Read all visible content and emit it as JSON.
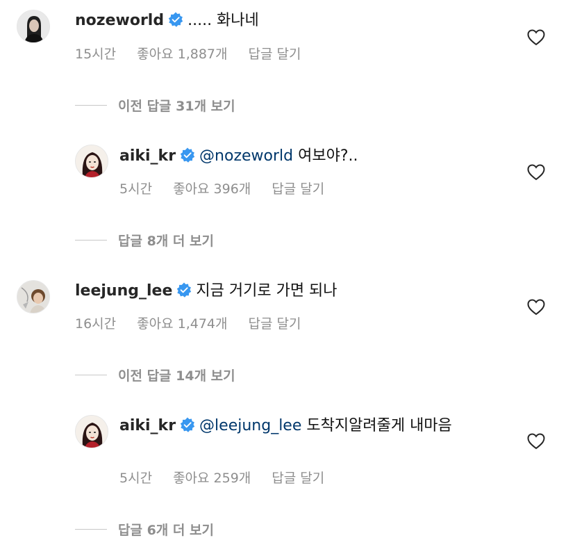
{
  "comments": [
    {
      "username": "nozeworld",
      "verified": true,
      "text": "..... 화나네",
      "time": "15시간",
      "likes": "좋아요 1,887개",
      "reply": "답글 달기",
      "more_replies": "이전 답글 31개 보기"
    },
    {
      "username": "aiki_kr",
      "verified": true,
      "mention": "@nozeworld",
      "text": "여보야?..",
      "time": "5시간",
      "likes": "좋아요 396개",
      "reply": "답글 달기",
      "more_replies": "답글 8개 더 보기"
    },
    {
      "username": "leejung_lee",
      "verified": true,
      "text": "지금 거기로 가면 되나",
      "time": "16시간",
      "likes": "좋아요 1,474개",
      "reply": "답글 달기",
      "more_replies": "이전 답글 14개 보기"
    },
    {
      "username": "aiki_kr",
      "verified": true,
      "mention": "@leejung_lee",
      "text": "도착지알려줄게 내마음",
      "time": "5시간",
      "likes": "좋아요 259개",
      "reply": "답글 달기",
      "more_replies": "답글 6개 더 보기"
    }
  ],
  "colors": {
    "verified_badge": "#3897f0",
    "mention": "#00376b",
    "meta_text": "#8e8e8e"
  },
  "icons": {
    "like": "heart-outline-icon",
    "verified": "verified-badge-icon"
  }
}
